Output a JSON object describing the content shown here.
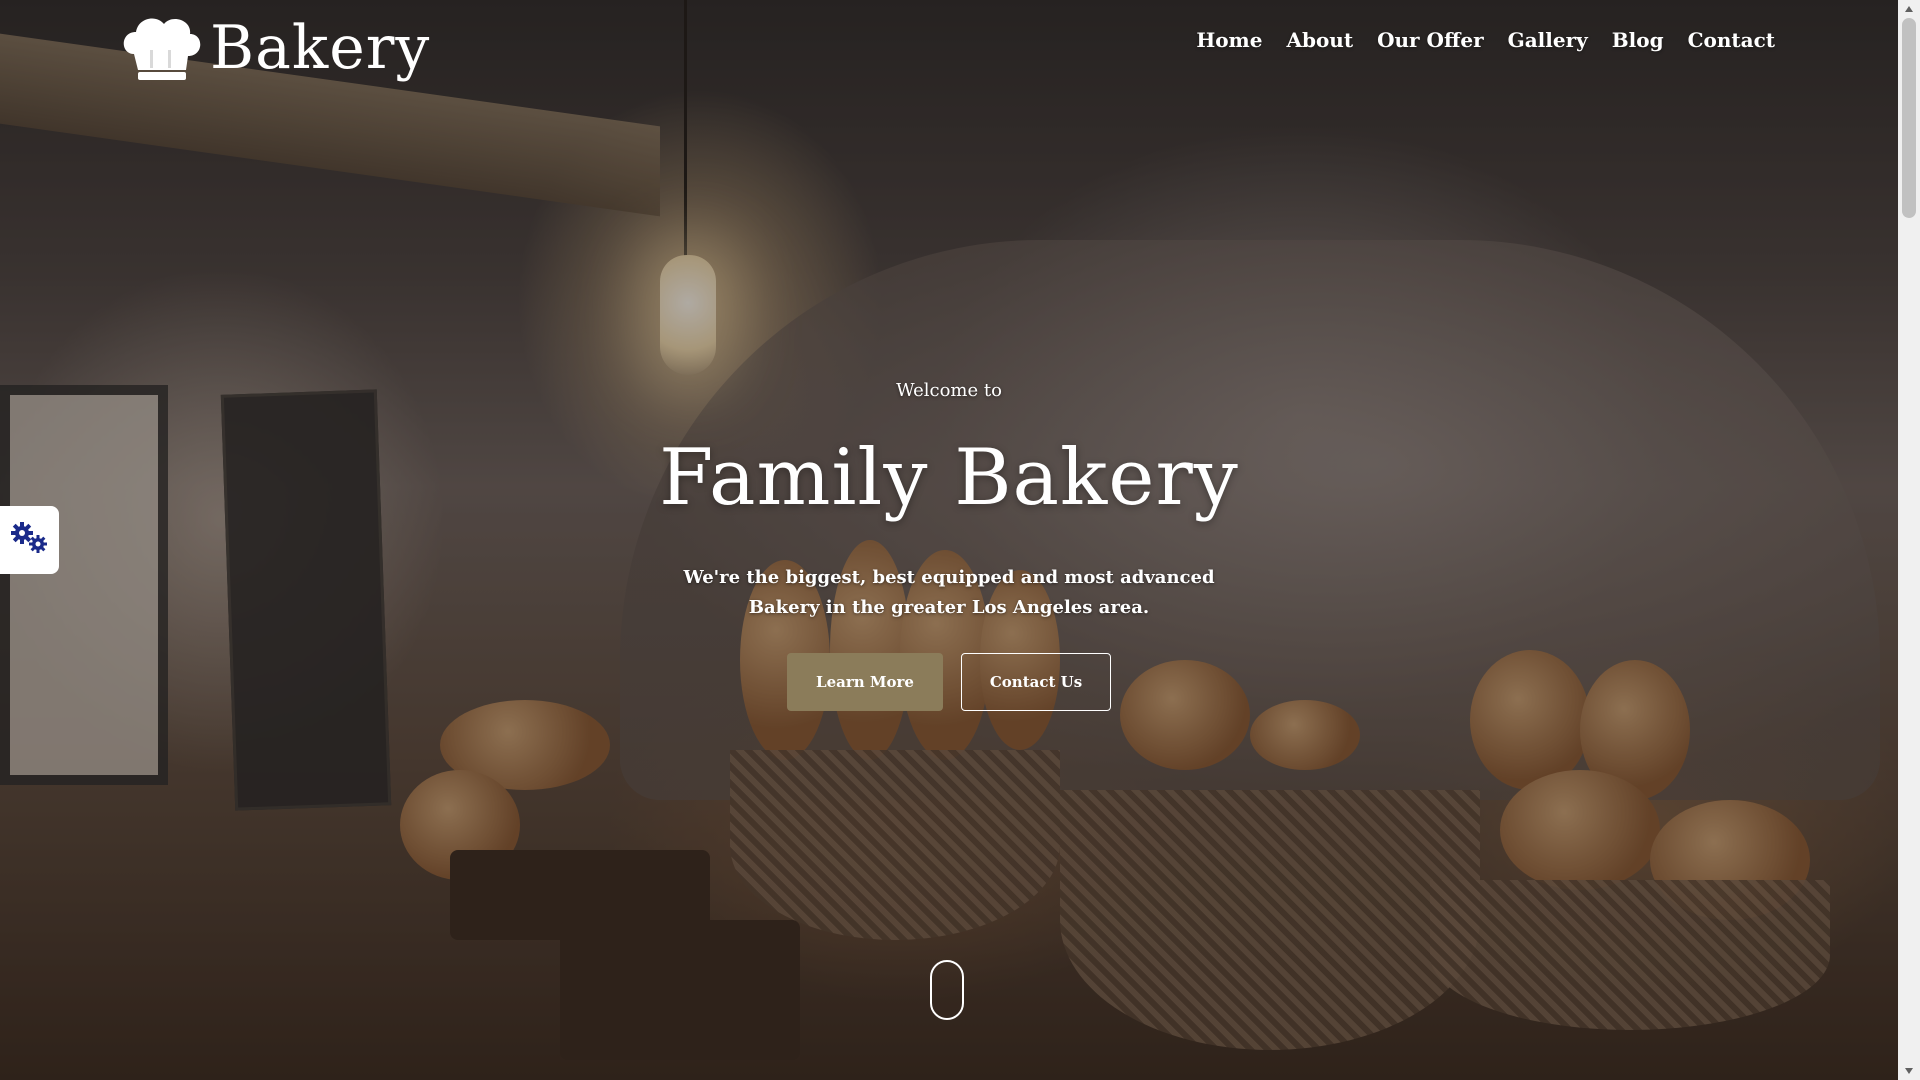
{
  "brand": {
    "name": "Bakery",
    "logo_icon": "chef-hat-icon"
  },
  "nav": {
    "items": [
      {
        "label": "Home"
      },
      {
        "label": "About"
      },
      {
        "label": "Our Offer"
      },
      {
        "label": "Gallery"
      },
      {
        "label": "Blog"
      },
      {
        "label": "Contact"
      }
    ]
  },
  "hero": {
    "welcome": "Welcome to",
    "title": "Family Bakery",
    "tagline": "We're the biggest, best equipped and most advanced Bakery in the greater Los Angeles area.",
    "primary_button": "Learn More",
    "secondary_button": "Contact Us"
  },
  "settings": {
    "icon": "gears-icon"
  },
  "colors": {
    "accent": "#8b7c5a",
    "text": "#ffffff",
    "settings_icon": "#1a2a8a"
  }
}
